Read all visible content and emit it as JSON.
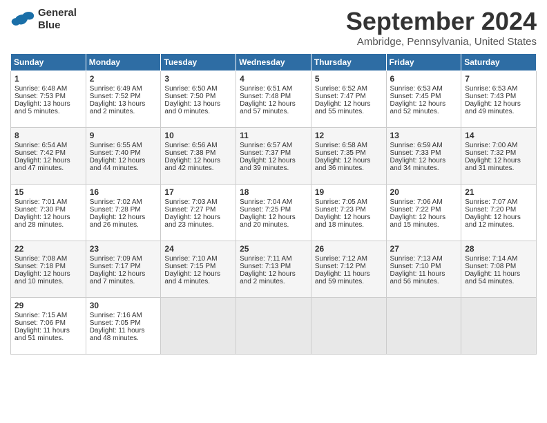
{
  "logo": {
    "line1": "General",
    "line2": "Blue"
  },
  "title": "September 2024",
  "subtitle": "Ambridge, Pennsylvania, United States",
  "days_of_week": [
    "Sunday",
    "Monday",
    "Tuesday",
    "Wednesday",
    "Thursday",
    "Friday",
    "Saturday"
  ],
  "weeks": [
    [
      {
        "day": 1,
        "sunrise": "6:48 AM",
        "sunset": "7:53 PM",
        "daylight": "13 hours and 5 minutes."
      },
      {
        "day": 2,
        "sunrise": "6:49 AM",
        "sunset": "7:52 PM",
        "daylight": "13 hours and 2 minutes."
      },
      {
        "day": 3,
        "sunrise": "6:50 AM",
        "sunset": "7:50 PM",
        "daylight": "13 hours and 0 minutes."
      },
      {
        "day": 4,
        "sunrise": "6:51 AM",
        "sunset": "7:48 PM",
        "daylight": "12 hours and 57 minutes."
      },
      {
        "day": 5,
        "sunrise": "6:52 AM",
        "sunset": "7:47 PM",
        "daylight": "12 hours and 55 minutes."
      },
      {
        "day": 6,
        "sunrise": "6:53 AM",
        "sunset": "7:45 PM",
        "daylight": "12 hours and 52 minutes."
      },
      {
        "day": 7,
        "sunrise": "6:53 AM",
        "sunset": "7:43 PM",
        "daylight": "12 hours and 49 minutes."
      }
    ],
    [
      {
        "day": 8,
        "sunrise": "6:54 AM",
        "sunset": "7:42 PM",
        "daylight": "12 hours and 47 minutes."
      },
      {
        "day": 9,
        "sunrise": "6:55 AM",
        "sunset": "7:40 PM",
        "daylight": "12 hours and 44 minutes."
      },
      {
        "day": 10,
        "sunrise": "6:56 AM",
        "sunset": "7:38 PM",
        "daylight": "12 hours and 42 minutes."
      },
      {
        "day": 11,
        "sunrise": "6:57 AM",
        "sunset": "7:37 PM",
        "daylight": "12 hours and 39 minutes."
      },
      {
        "day": 12,
        "sunrise": "6:58 AM",
        "sunset": "7:35 PM",
        "daylight": "12 hours and 36 minutes."
      },
      {
        "day": 13,
        "sunrise": "6:59 AM",
        "sunset": "7:33 PM",
        "daylight": "12 hours and 34 minutes."
      },
      {
        "day": 14,
        "sunrise": "7:00 AM",
        "sunset": "7:32 PM",
        "daylight": "12 hours and 31 minutes."
      }
    ],
    [
      {
        "day": 15,
        "sunrise": "7:01 AM",
        "sunset": "7:30 PM",
        "daylight": "12 hours and 28 minutes."
      },
      {
        "day": 16,
        "sunrise": "7:02 AM",
        "sunset": "7:28 PM",
        "daylight": "12 hours and 26 minutes."
      },
      {
        "day": 17,
        "sunrise": "7:03 AM",
        "sunset": "7:27 PM",
        "daylight": "12 hours and 23 minutes."
      },
      {
        "day": 18,
        "sunrise": "7:04 AM",
        "sunset": "7:25 PM",
        "daylight": "12 hours and 20 minutes."
      },
      {
        "day": 19,
        "sunrise": "7:05 AM",
        "sunset": "7:23 PM",
        "daylight": "12 hours and 18 minutes."
      },
      {
        "day": 20,
        "sunrise": "7:06 AM",
        "sunset": "7:22 PM",
        "daylight": "12 hours and 15 minutes."
      },
      {
        "day": 21,
        "sunrise": "7:07 AM",
        "sunset": "7:20 PM",
        "daylight": "12 hours and 12 minutes."
      }
    ],
    [
      {
        "day": 22,
        "sunrise": "7:08 AM",
        "sunset": "7:18 PM",
        "daylight": "12 hours and 10 minutes."
      },
      {
        "day": 23,
        "sunrise": "7:09 AM",
        "sunset": "7:17 PM",
        "daylight": "12 hours and 7 minutes."
      },
      {
        "day": 24,
        "sunrise": "7:10 AM",
        "sunset": "7:15 PM",
        "daylight": "12 hours and 4 minutes."
      },
      {
        "day": 25,
        "sunrise": "7:11 AM",
        "sunset": "7:13 PM",
        "daylight": "12 hours and 2 minutes."
      },
      {
        "day": 26,
        "sunrise": "7:12 AM",
        "sunset": "7:12 PM",
        "daylight": "11 hours and 59 minutes."
      },
      {
        "day": 27,
        "sunrise": "7:13 AM",
        "sunset": "7:10 PM",
        "daylight": "11 hours and 56 minutes."
      },
      {
        "day": 28,
        "sunrise": "7:14 AM",
        "sunset": "7:08 PM",
        "daylight": "11 hours and 54 minutes."
      }
    ],
    [
      {
        "day": 29,
        "sunrise": "7:15 AM",
        "sunset": "7:06 PM",
        "daylight": "11 hours and 51 minutes."
      },
      {
        "day": 30,
        "sunrise": "7:16 AM",
        "sunset": "7:05 PM",
        "daylight": "11 hours and 48 minutes."
      },
      null,
      null,
      null,
      null,
      null
    ]
  ]
}
